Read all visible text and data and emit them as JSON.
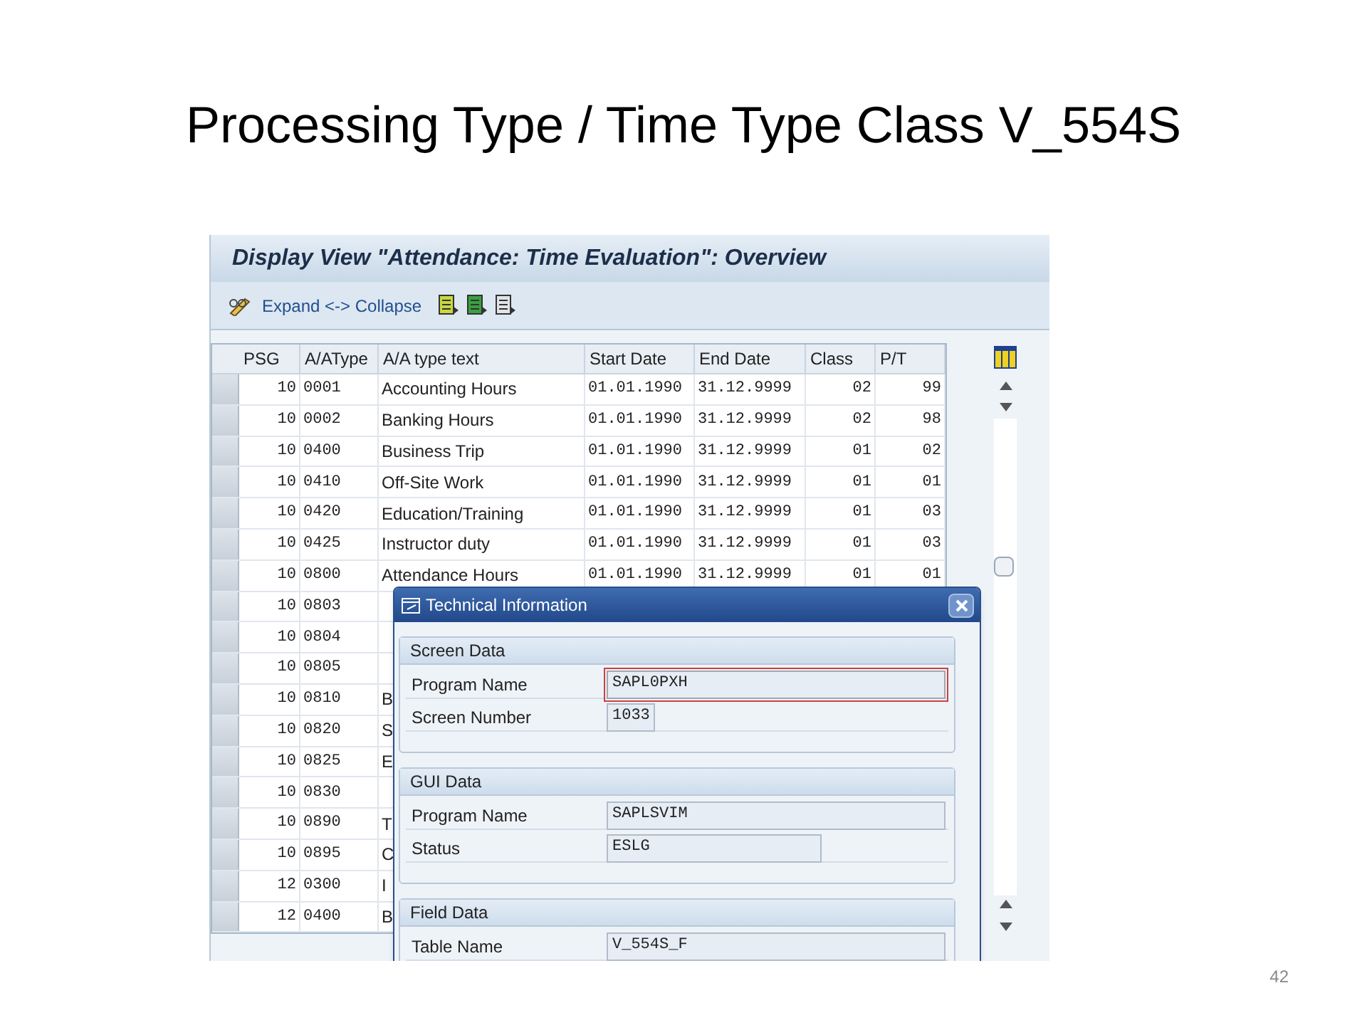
{
  "slide": {
    "title": "Processing Type / Time Type Class V_554S",
    "page_number": "42"
  },
  "window": {
    "title": "Display View \"Attendance: Time Evaluation\": Overview",
    "toolbar": {
      "expand_collapse": "Expand <-> Collapse"
    }
  },
  "table": {
    "columns": [
      "PSG",
      "A/AType",
      "A/A type text",
      "Start Date",
      "End Date",
      "Class",
      "P/T"
    ],
    "rows": [
      {
        "cells": [
          "10",
          "0001",
          "Accounting Hours",
          "01.01.1990",
          "31.12.9999",
          "02",
          "99"
        ]
      },
      {
        "cells": [
          "10",
          "0002",
          "Banking Hours",
          "01.01.1990",
          "31.12.9999",
          "02",
          "98"
        ]
      },
      {
        "cells": [
          "10",
          "0400",
          "Business Trip",
          "01.01.1990",
          "31.12.9999",
          "01",
          "02"
        ]
      },
      {
        "cells": [
          "10",
          "0410",
          "Off-Site Work",
          "01.01.1990",
          "31.12.9999",
          "01",
          "01"
        ]
      },
      {
        "cells": [
          "10",
          "0420",
          "Education/Training",
          "01.01.1990",
          "31.12.9999",
          "01",
          "03"
        ]
      },
      {
        "cells": [
          "10",
          "0425",
          "Instructor duty",
          "01.01.1990",
          "31.12.9999",
          "01",
          "03"
        ]
      },
      {
        "cells": [
          "10",
          "0800",
          "Attendance Hours",
          "01.01.1990",
          "31.12.9999",
          "01",
          "01"
        ]
      },
      {
        "cells": [
          "10",
          "0803"
        ]
      },
      {
        "cells": [
          "10",
          "0804"
        ]
      },
      {
        "cells": [
          "10",
          "0805"
        ]
      },
      {
        "cells": [
          "10",
          "0810",
          "B"
        ]
      },
      {
        "cells": [
          "10",
          "0820",
          "S"
        ]
      },
      {
        "cells": [
          "10",
          "0825",
          "E"
        ]
      },
      {
        "cells": [
          "10",
          "0830"
        ]
      },
      {
        "cells": [
          "10",
          "0890",
          "T"
        ]
      },
      {
        "cells": [
          "10",
          "0895",
          "C"
        ]
      },
      {
        "cells": [
          "12",
          "0300",
          "I"
        ]
      },
      {
        "cells": [
          "12",
          "0400",
          "B"
        ]
      }
    ]
  },
  "dialog": {
    "title": "Technical Information",
    "sections": [
      {
        "title": "Screen Data",
        "fields": [
          {
            "label": "Program Name",
            "value": "SAPL0PXH",
            "focused": true
          },
          {
            "label": "Screen Number",
            "value": "1033",
            "focused": false
          }
        ]
      },
      {
        "title": "GUI Data",
        "fields": [
          {
            "label": "Program Name",
            "value": "SAPLSVIM",
            "focused": false
          },
          {
            "label": "Status",
            "value": "ESLG",
            "focused": false
          }
        ]
      },
      {
        "title": "Field Data",
        "fields": [
          {
            "label": "Table Name",
            "value": "V_554S_F",
            "focused": false
          }
        ]
      }
    ]
  }
}
